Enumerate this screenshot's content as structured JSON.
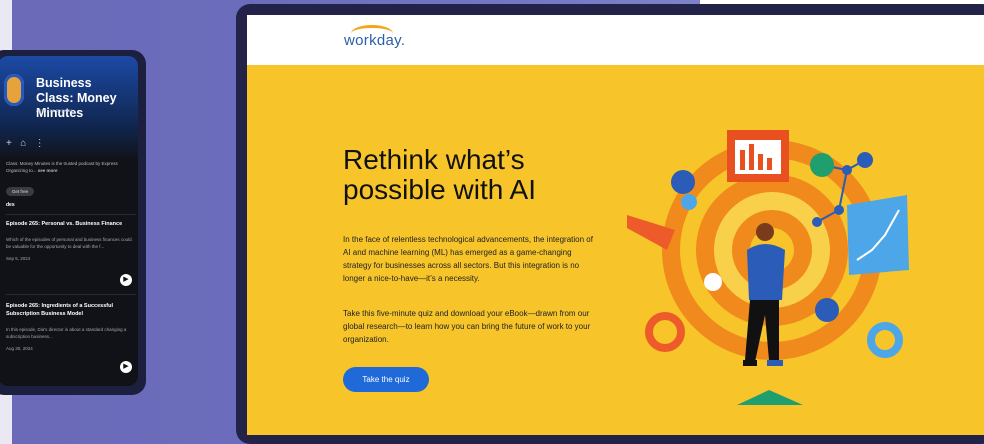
{
  "phone": {
    "title": "Business Class: Money Minutes",
    "subtitle": "American Express",
    "description": "Class: Money Minutes is the trusted podcast by Express Organizing to...",
    "see_more": "see more",
    "follow_pill": "Get free",
    "section": "des",
    "episodes": [
      {
        "title": "Episode 265: Personal vs. Business Finance",
        "desc": "Which of the episodes of personal and business finances could be valuable for the opportunity to deal with the f...",
        "date": "Sep 5, 2024"
      },
      {
        "title": "Episode 265: Ingredients of a Successful Subscription Business Model",
        "desc": "In this episode, Dia's director is about a standard changing a subscription business...",
        "date": "Aug 30, 2024"
      }
    ]
  },
  "screen": {
    "logo": "workday.",
    "headline": "Rethink what’s possible with AI",
    "paragraph1": "In the face of relentless technological advancements, the integration of AI and machine learning (ML) has emerged as a game-changing strategy for businesses across all sectors. But this integration is no longer a nice-to-have—it’s a necessity.",
    "paragraph2": "Take this five-minute quiz and download your eBook—drawn from our global research—to learn how you can bring the future of work to your organization.",
    "cta_label": "Take the quiz"
  },
  "colors": {
    "background": "#6b6cbb",
    "screen_yellow": "#f7c52a",
    "orange": "#f08a1c",
    "workday_blue": "#2b5fa8",
    "cta_blue": "#1f6ad8"
  }
}
